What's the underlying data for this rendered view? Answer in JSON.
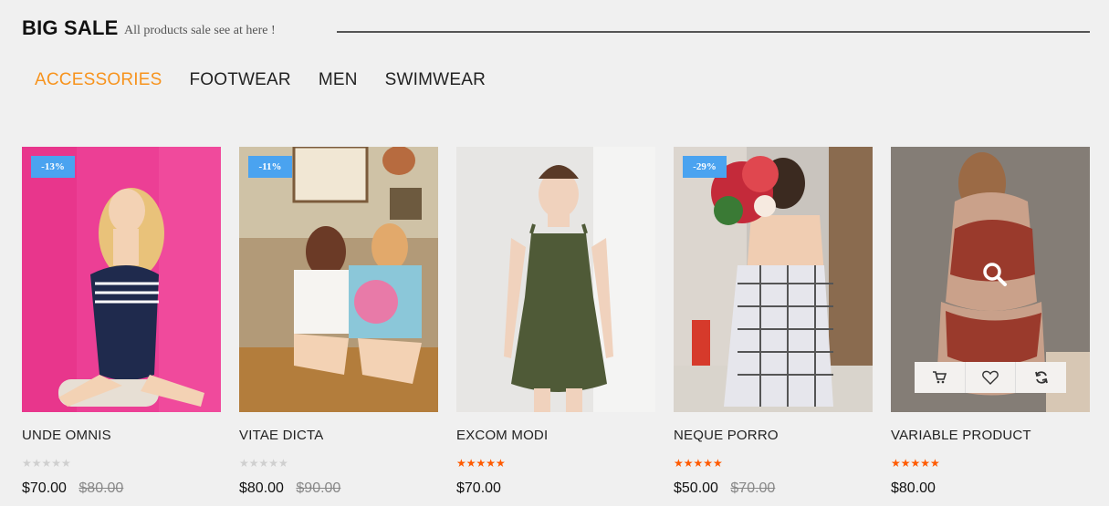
{
  "header": {
    "title": "BIG SALE",
    "subtitle": "All products sale see at here !"
  },
  "tabs": [
    "ACCESSORIES",
    "FOOTWEAR",
    "MEN",
    "SWIMWEAR"
  ],
  "active_tab": "ACCESSORIES",
  "colors": {
    "accent": "#f7931d",
    "badge": "#4aa3f0",
    "star": "#ff5a00"
  },
  "products": [
    {
      "name": "UNDE OMNIS",
      "badge": "-13%",
      "price": "$70.00",
      "old_price": "$80.00",
      "rating": 0
    },
    {
      "name": "VITAE DICTA",
      "badge": "-11%",
      "price": "$80.00",
      "old_price": "$90.00",
      "rating": 0
    },
    {
      "name": "EXCOM MODI",
      "badge": "",
      "price": "$70.00",
      "old_price": "",
      "rating": 5
    },
    {
      "name": "NEQUE PORRO",
      "badge": "-29%",
      "price": "$50.00",
      "old_price": "$70.00",
      "rating": 5
    },
    {
      "name": "VARIABLE PRODUCT",
      "badge": "",
      "price": "$80.00",
      "old_price": "",
      "rating": 5
    }
  ],
  "icons": {
    "quick_view": "search-icon",
    "cart": "cart-icon",
    "wishlist": "heart-icon",
    "compare": "refresh-icon"
  }
}
